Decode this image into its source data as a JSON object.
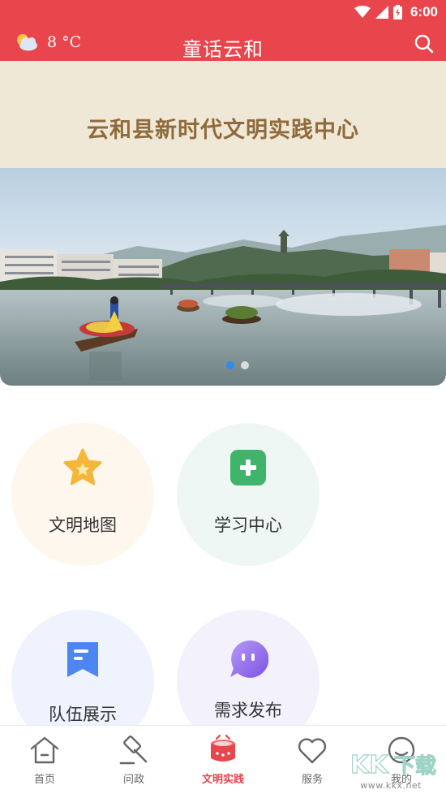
{
  "status_bar": {
    "time": "6:00"
  },
  "header": {
    "temperature": "8 °C",
    "title": "童话云和"
  },
  "banner": {
    "title": "云和县新时代文明实践中心",
    "slide_count": 2,
    "active_slide": 1
  },
  "features": [
    {
      "label": "文明地图",
      "icon": "star-icon"
    },
    {
      "label": "学习中心",
      "icon": "plus-icon"
    },
    {
      "label": "队伍展示",
      "icon": "bookmark-icon"
    },
    {
      "label": "需求发布",
      "icon": "chat-bubble-icon"
    }
  ],
  "bottom_nav": [
    {
      "label": "首页",
      "icon": "home-icon",
      "active": false
    },
    {
      "label": "问政",
      "icon": "gavel-icon",
      "active": false
    },
    {
      "label": "文明实践",
      "icon": "drum-icon",
      "active": true
    },
    {
      "label": "服务",
      "icon": "heart-icon",
      "active": false
    },
    {
      "label": "我的",
      "icon": "smile-icon",
      "active": false
    }
  ],
  "watermark": {
    "logo_text": "KK下载",
    "url": "www.kkx.net"
  },
  "colors": {
    "brand_red": "#e8454d",
    "banner_bg": "#efe8d6",
    "banner_text": "#8f6a3b",
    "dot_active": "#2f8af0"
  }
}
